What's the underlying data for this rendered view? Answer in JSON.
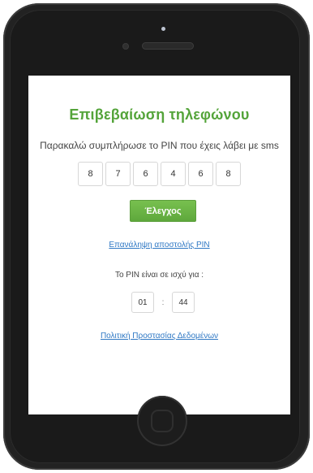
{
  "page": {
    "title": "Επιβεβαίωση τηλεφώνου",
    "instruction": "Παρακαλώ συμπλήρωσε το PIN που έχεις λάβει με sms",
    "pin_digits": [
      "8",
      "7",
      "6",
      "4",
      "6",
      "8"
    ],
    "verify_button": "Έλεγχος",
    "resend_link": "Επανάληψη αποστολής PIN",
    "valid_text": "Το PIN είναι σε ισχύ για :",
    "timer": {
      "minutes": "01",
      "separator": ":",
      "seconds": "44"
    },
    "privacy_link": "Πολιτική Προστασίας Δεδομένων"
  },
  "colors": {
    "accent": "#54a43a",
    "link": "#2f78c4",
    "phone_body": "#222222"
  }
}
